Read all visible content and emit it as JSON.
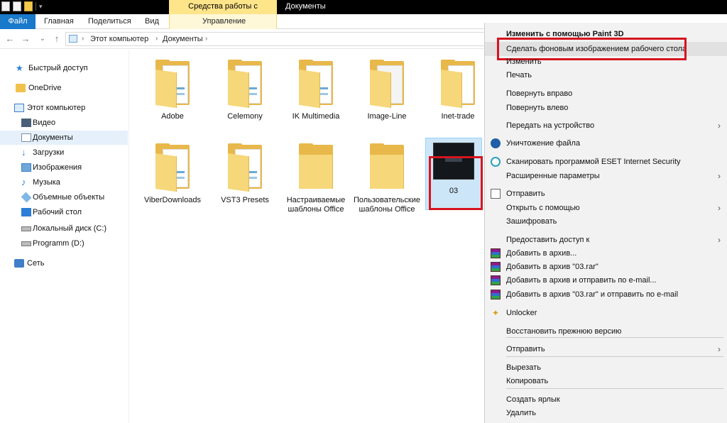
{
  "title_bar": {
    "tools_context": "Средства работы с рисунками",
    "window_title": "Документы"
  },
  "ribbon": {
    "tabs": [
      "Файл",
      "Главная",
      "Поделиться",
      "Вид"
    ],
    "manage_tab": "Управление"
  },
  "address": {
    "back": "←",
    "forward": "→",
    "recent": "⌄",
    "up": "↑",
    "crumbs": [
      "Этот компьютер",
      "Документы"
    ]
  },
  "nav": {
    "items": [
      {
        "label": "Быстрый доступ",
        "icon": "star-icon"
      },
      {
        "label": "OneDrive",
        "icon": "onedrive-icon"
      },
      {
        "label": "Этот компьютер",
        "icon": "pc-icon"
      },
      {
        "label": "Видео",
        "icon": "video-icon"
      },
      {
        "label": "Документы",
        "icon": "documents-icon"
      },
      {
        "label": "Загрузки",
        "icon": "downloads-icon"
      },
      {
        "label": "Изображения",
        "icon": "pictures-icon"
      },
      {
        "label": "Музыка",
        "icon": "music-icon"
      },
      {
        "label": "Объемные объекты",
        "icon": "3d-objects-icon"
      },
      {
        "label": "Рабочий стол",
        "icon": "desktop-icon"
      },
      {
        "label": "Локальный диск (C:)",
        "icon": "drive-c-icon"
      },
      {
        "label": "Programm (D:)",
        "icon": "drive-d-icon"
      },
      {
        "label": "Сеть",
        "icon": "network-icon"
      }
    ]
  },
  "files": [
    {
      "name": "Adobe"
    },
    {
      "name": "Celemony"
    },
    {
      "name": "IK Multimedia"
    },
    {
      "name": "Image-Line"
    },
    {
      "name": "Inet-trade"
    },
    {
      "name": "ViberDownloads"
    },
    {
      "name": "VST3 Presets"
    },
    {
      "name": "Настраиваемые шаблоны Office"
    },
    {
      "name": "Пользовательские шаблоны Office"
    },
    {
      "name": "03"
    }
  ],
  "context_menu": {
    "items": [
      "Изменить с помощью Paint 3D",
      "Сделать фоновым изображением рабочего стола",
      "Изменить",
      "Печать",
      "Повернуть вправо",
      "Повернуть влево",
      "Передать на устройство",
      "Уничтожение файла",
      "Сканировать программой ESET Internet Security",
      "Расширенные параметры",
      "Отправить",
      "Открыть с помощью",
      "Зашифровать",
      "Предоставить доступ к",
      "Добавить в архив...",
      "Добавить в архив \"03.rar\"",
      "Добавить в архив и отправить по e-mail...",
      "Добавить в архив \"03.rar\" и отправить по e-mail",
      "Unlocker",
      "Восстановить прежнюю версию",
      "Отправить",
      "Вырезать",
      "Копировать",
      "Создать ярлык",
      "Удалить"
    ],
    "submenu_arrow": "›",
    "highlight_color": "#d6141f"
  }
}
